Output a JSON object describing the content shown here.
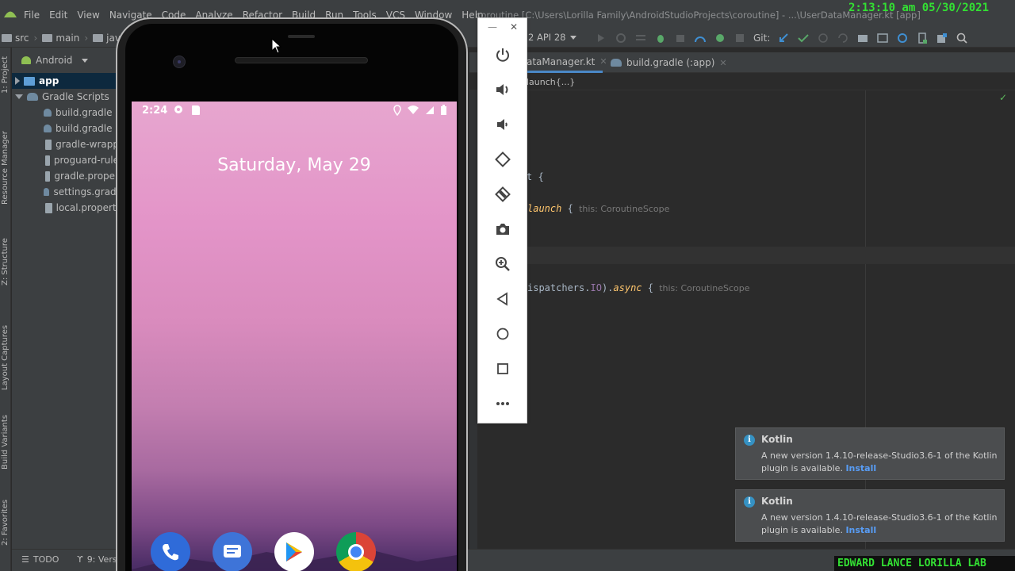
{
  "menu": [
    "File",
    "Edit",
    "View",
    "Navigate",
    "Code",
    "Analyze",
    "Refactor",
    "Build",
    "Run",
    "Tools",
    "VCS",
    "Window",
    "Help"
  ],
  "window_title": "coroutine [C:\\Users\\Lorilla Family\\AndroidStudioProjects\\coroutine] - ...\\UserDataManager.kt [app]",
  "clock": "2:13:10 am 05/30/2021",
  "breadcrumb": [
    "src",
    "main",
    "java"
  ],
  "toolbar": {
    "device": "2 API 28",
    "git_label": "Git:"
  },
  "side_labels": [
    "1: Project",
    "Resource Manager",
    "Z: Structure",
    "Layout Captures",
    "Build Variants",
    "2: Favorites"
  ],
  "project": {
    "view": "Android",
    "root": "app",
    "group": "Gradle Scripts",
    "files": [
      "build.gradle (",
      "build.gradle (",
      "gradle-wrapp",
      "proguard-rule",
      "gradle.proper",
      "settings.gradl",
      "local.properti"
    ]
  },
  "bottom": {
    "todo": "TODO",
    "version": "9: Vers"
  },
  "editor": {
    "tabs": [
      "ataManager.kt",
      "build.gradle (:app)"
    ],
    "crumb": "launch{...}",
    "line1_text": "t {",
    "line2_fn": "launch",
    "line2_brace": "{",
    "line2_hint": "this: CoroutineScope",
    "line3_pre": "ispatchers.",
    "line3_io": "IO",
    "line3_mid": ").",
    "line3_fn": "async",
    "line3_brace": "{",
    "line3_hint": "this: CoroutineScope"
  },
  "phone": {
    "time": "2:24",
    "date": "Saturday, May 29"
  },
  "notifications": [
    {
      "title": "Kotlin",
      "body": "A new version 1.4.10-release-Studio3.6-1 of the Kotlin plugin is available.",
      "link": "Install"
    },
    {
      "title": "Kotlin",
      "body": "A new version 1.4.10-release-Studio3.6-1 of the Kotlin plugin is available.",
      "link": "Install"
    }
  ],
  "watermark": "EDWARD LANCE LORILLA LAB",
  "colors": {
    "accent": "#4a88c7",
    "ide_bg": "#2b2b2b",
    "panel_bg": "#3c3f41",
    "link": "#589df6",
    "green": "#33e033"
  }
}
